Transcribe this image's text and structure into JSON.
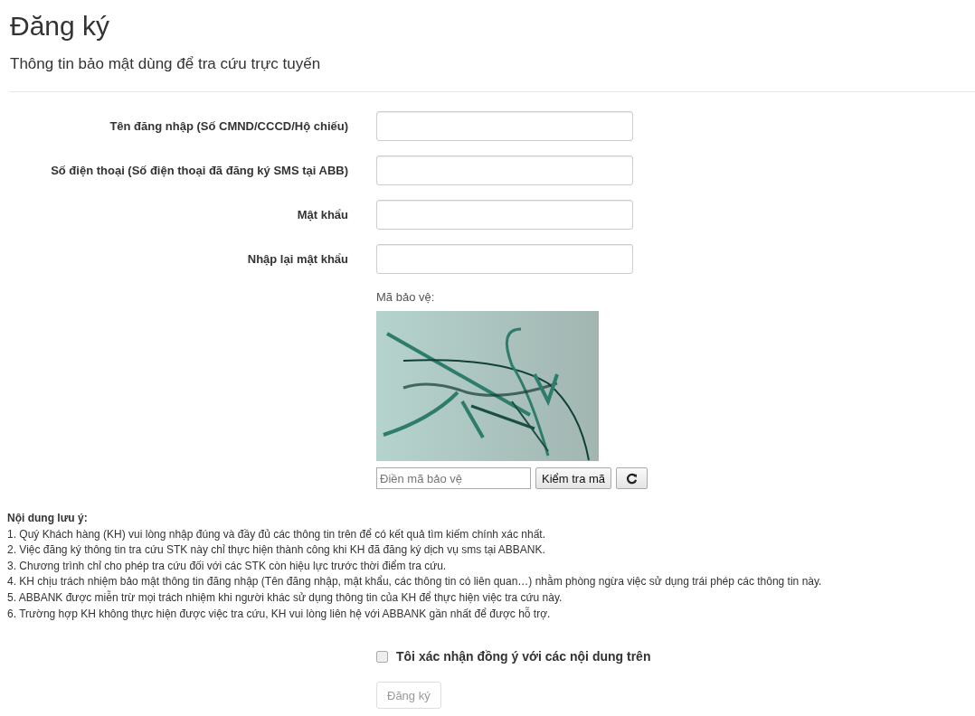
{
  "header": {
    "title": "Đăng ký",
    "subtitle": "Thông tin bảo mật dùng để tra cứu trực tuyến"
  },
  "fields": [
    {
      "label": "Tên đăng nhập (Số CMND/CCCD/Hộ chiếu)"
    },
    {
      "label": "Số điện thoại (Số điện thoại đã đăng ký SMS tại ABB)"
    },
    {
      "label": "Mật khẩu"
    },
    {
      "label": "Nhập lại mật khẩu"
    }
  ],
  "captcha": {
    "label": "Mã bảo vệ:",
    "placeholder": "Điền mã bảo vệ",
    "check_button": "Kiểm tra mã"
  },
  "notes": {
    "title": "Nội dung lưu ý:",
    "items": [
      "1. Quý Khách hàng (KH) vui lòng nhập đúng và đầy đủ các thông tin trên để có kết quả tìm kiếm chính xác nhất.",
      "2. Việc đăng ký thông tin tra cứu STK này chỉ thực hiện thành công khi KH đã đăng ký dịch vụ sms tại ABBANK.",
      "3. Chương trình chỉ cho phép tra cứu đối với các STK còn hiệu lực trước thời điểm tra cứu.",
      "4. KH chịu trách nhiệm bảo mật thông tin đăng nhập (Tên đăng nhập, mật khẩu, các thông tin có liên quan…) nhằm phòng ngừa việc sử dụng trái phép các thông tin này.",
      "5. ABBANK được miễn trừ mọi trách nhiệm khi người khác sử dụng thông tin của KH để thực hiện việc tra cứu này.",
      "6. Trường hợp KH không thực hiện được việc tra cứu, KH vui lòng liên hệ với ABBANK gần nhất để được hỗ trợ."
    ]
  },
  "agreement": {
    "label": "Tôi xác nhận đồng ý với các nội dung trên",
    "checked": false
  },
  "submit": {
    "label": "Đăng ký",
    "disabled": true
  }
}
